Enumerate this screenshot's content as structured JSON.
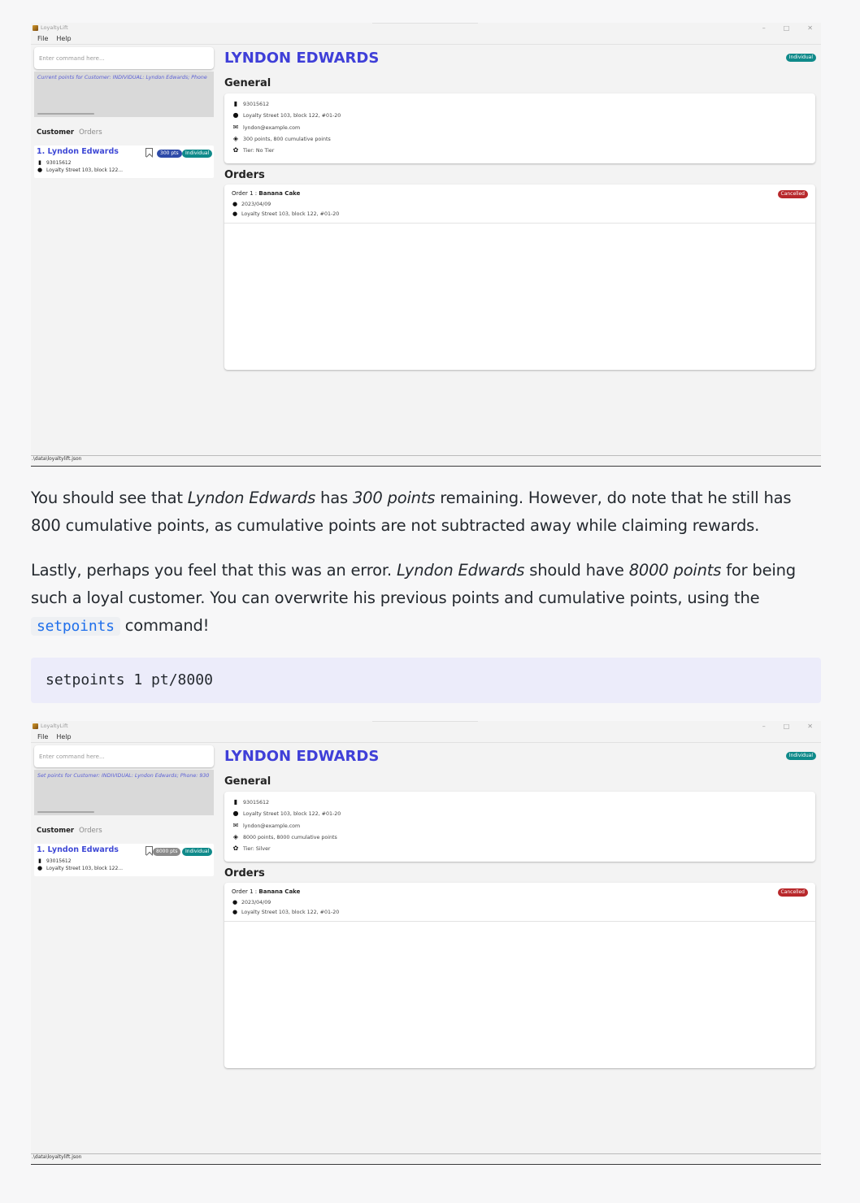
{
  "screenshots": [
    {
      "app_title": "LoyaltyLift",
      "menu": [
        "File",
        "Help"
      ],
      "command_placeholder": "Enter command here...",
      "result_text": "Current points for Customer: INDIVIDUAL: Lyndon Edwards; Phone",
      "tabs": {
        "customer": "Customer",
        "orders": "Orders"
      },
      "customer_card": {
        "name": "1. Lyndon Edwards",
        "phone": "93015612",
        "address": "Loyalty Street 103, block 122...",
        "points_badge": "300 pts",
        "type_badge": "Individual"
      },
      "detail": {
        "name": "LYNDON EDWARDS",
        "type_badge": "Individual",
        "general_heading": "General",
        "phone": "93015612",
        "address": "Loyalty Street 103, block 122, #01-20",
        "email": "lyndon@example.com",
        "points": "300 points, 800 cumulative points",
        "tier": "Tier: No Tier",
        "orders_heading": "Orders",
        "order_label": "Order 1 : ",
        "order_name": "Banana Cake",
        "order_date": "2023/04/09",
        "order_address": "Loyalty Street 103, block 122, #01-20",
        "order_status": "Cancelled"
      },
      "status_path": ".\\data\\loyaltylift.json"
    },
    {
      "app_title": "LoyaltyLift",
      "menu": [
        "File",
        "Help"
      ],
      "command_placeholder": "Enter command here...",
      "result_text": "Set points for Customer: INDIVIDUAL: Lyndon Edwards; Phone: 930",
      "tabs": {
        "customer": "Customer",
        "orders": "Orders"
      },
      "customer_card": {
        "name": "1. Lyndon Edwards",
        "phone": "93015612",
        "address": "Loyalty Street 103, block 122...",
        "points_badge": "8000 pts",
        "type_badge": "Individual"
      },
      "detail": {
        "name": "LYNDON EDWARDS",
        "type_badge": "Individual",
        "general_heading": "General",
        "phone": "93015612",
        "address": "Loyalty Street 103, block 122, #01-20",
        "email": "lyndon@example.com",
        "points": "8000 points, 8000 cumulative points",
        "tier": "Tier: Silver",
        "orders_heading": "Orders",
        "order_label": "Order 1 : ",
        "order_name": "Banana Cake",
        "order_date": "2023/04/09",
        "order_address": "Loyalty Street 103, block 122, #01-20",
        "order_status": "Cancelled"
      },
      "status_path": ".\\data\\loyaltylift.json"
    }
  ],
  "paragraph1": {
    "p1": "You should see that ",
    "i1": "Lyndon Edwards",
    "p2": " has ",
    "i2": "300 points",
    "p3": " remaining. However, do note that he still has 800 cumulative points, as cumulative points are not subtracted away while claiming rewards."
  },
  "paragraph2": {
    "p1": "Lastly, perhaps you feel that this was an error. ",
    "i1": "Lyndon Edwards",
    "p2": " should have ",
    "i2": "8000 points",
    "p3": " for being such a loyal customer. You can overwrite his previous points and cumulative points, using the ",
    "code": "setpoints",
    "p4": " command!"
  },
  "code_block": "setpoints 1 pt/8000",
  "colors": {
    "accent": "#3f3fd8",
    "badge_points": "#2d4aa8",
    "badge_points_updated": "#8a8a8a",
    "badge_individual": "#0f8a8a",
    "badge_cancelled": "#b8282b"
  }
}
